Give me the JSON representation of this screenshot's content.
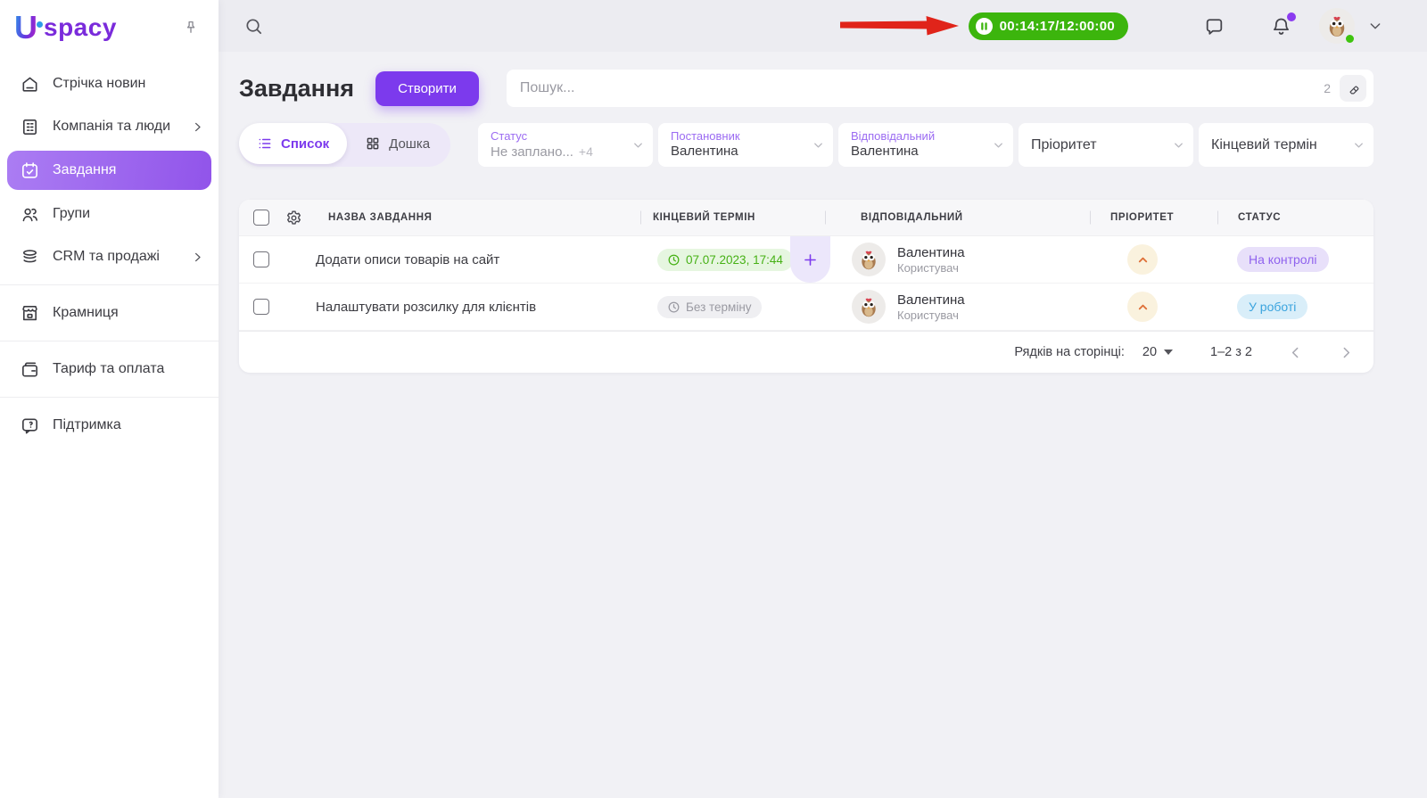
{
  "brand": {
    "mark": "U",
    "rest": "spacy"
  },
  "sidebar": {
    "items": [
      {
        "label": "Стрічка новин"
      },
      {
        "label": "Компанія та люди",
        "expandable": true
      },
      {
        "label": "Завдання",
        "active": true
      },
      {
        "label": "Групи"
      },
      {
        "label": "CRM та продажі",
        "expandable": true
      },
      {
        "label": "Крамниця"
      },
      {
        "label": "Тариф та оплата"
      },
      {
        "label": "Підтримка"
      }
    ]
  },
  "topbar": {
    "timer_value": "00:14:17/12:00:00"
  },
  "page": {
    "title": "Завдання",
    "create_button": "Створити",
    "search_placeholder": "Пошук...",
    "filter_count": "2"
  },
  "tabs": [
    {
      "label": "Список",
      "active": true
    },
    {
      "label": "Дошка",
      "active": false
    }
  ],
  "filters": [
    {
      "label": "Статус",
      "value": "Не заплано...",
      "extra": "+4"
    },
    {
      "label": "Постановник",
      "value": "Валентина"
    },
    {
      "label": "Відповідальний",
      "value": "Валентина"
    },
    {
      "label": "Пріоритет",
      "value": ""
    },
    {
      "label": "Кінцевий термін",
      "value": ""
    }
  ],
  "table": {
    "columns": {
      "name": "НАЗВА ЗАВДАННЯ",
      "deadline": "КІНЦЕВИЙ ТЕРМІН",
      "assignee": "ВІДПОВІДАЛЬНИЙ",
      "priority": "ПРІОРИТЕТ",
      "status": "СТАТУС"
    },
    "rows": [
      {
        "name": "Додати описи товарів на сайт",
        "deadline": "07.07.2023, 17:44",
        "assignee_name": "Валентина",
        "assignee_role": "Користувач",
        "status": "На контролі"
      },
      {
        "name": "Налаштувати розсилку для клієнтів",
        "deadline": "Без терміну",
        "assignee_name": "Валентина",
        "assignee_role": "Користувач",
        "status": "У роботі"
      }
    ],
    "pagination": {
      "rows_per_page_label": "Рядків на сторінці:",
      "rows_per_page_value": "20",
      "range": "1–2 з 2"
    }
  },
  "colors": {
    "accent_purple": "#7C3AED",
    "timer_green": "#3CB50D",
    "annotation_arrow_red": "#E0241A",
    "status_control_bg": "#E8E0FA",
    "status_control_text": "#8F62EE",
    "status_inwork_bg": "#D9EEF9",
    "status_inwork_text": "#3BA4DE",
    "deadline_green_text": "#46B115",
    "priority_circle_bg": "#FAF2DE"
  },
  "icons": [
    "search-icon",
    "pin-icon",
    "home-icon",
    "company-icon",
    "tasks-calendar-icon",
    "groups-icon",
    "crm-stack-icon",
    "store-icon",
    "wallet-icon",
    "support-icon",
    "pause-icon",
    "chat-icon",
    "bell-icon",
    "chevron-down-icon",
    "chevron-right-icon",
    "list-icon",
    "board-grid-icon",
    "gear-icon",
    "eraser-icon",
    "clock-icon",
    "plus-icon",
    "owl-avatar"
  ]
}
